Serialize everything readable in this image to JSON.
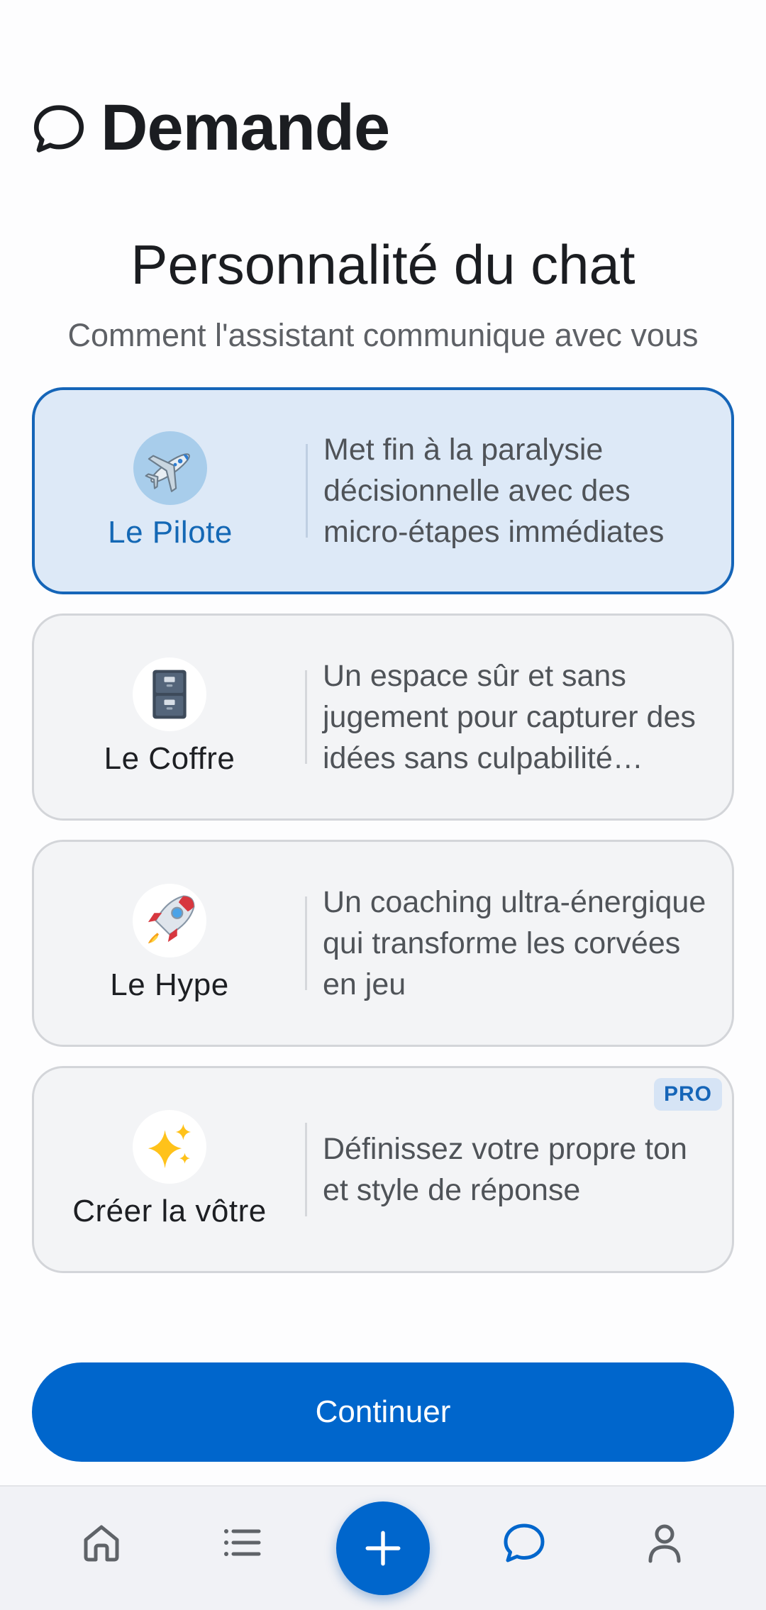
{
  "header": {
    "title": "Demande",
    "icon": "chat-bubble-icon"
  },
  "section": {
    "title": "Personnalité du chat",
    "subtitle": "Comment l'assistant communique avec vous"
  },
  "personalities": [
    {
      "name": "Le Pilote",
      "description": "Met fin à la paralysie décisionnelle avec des micro-étapes immédiates",
      "icon": "airplane-icon",
      "selected": true
    },
    {
      "name": "Le Coffre",
      "description": "Un espace sûr et sans jugement pour capturer des idées sans culpabilité…",
      "icon": "file-cabinet-icon",
      "selected": false
    },
    {
      "name": "Le Hype",
      "description": "Un coaching ultra-énergique qui transforme les corvées en jeu",
      "icon": "rocket-icon",
      "selected": false
    },
    {
      "name": "Créer la vôtre",
      "description": "Définissez votre propre ton et style de réponse",
      "icon": "sparkles-icon",
      "selected": false,
      "badge": "PRO"
    }
  ],
  "continue_label": "Continuer",
  "bottom_nav": [
    {
      "name": "home",
      "icon": "home-icon",
      "active": false
    },
    {
      "name": "list",
      "icon": "list-icon",
      "active": false
    },
    {
      "name": "add",
      "icon": "plus-icon",
      "active": false
    },
    {
      "name": "chat",
      "icon": "chat-bubble-icon",
      "active": true
    },
    {
      "name": "profile",
      "icon": "person-icon",
      "active": false
    }
  ],
  "colors": {
    "accent": "#0066cc",
    "selected_bg": "#dde9f7",
    "selected_border": "#1565b8",
    "card_bg": "#f3f4f6",
    "card_border": "#d3d5d9",
    "nav_bg": "#f1f2f6"
  }
}
